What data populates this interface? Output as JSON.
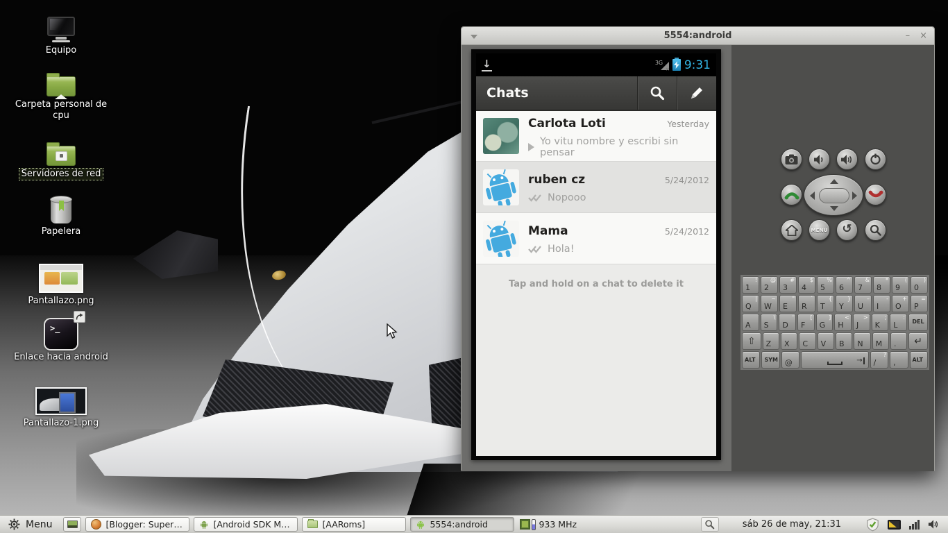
{
  "desktop": {
    "icons": [
      {
        "label": "Equipo"
      },
      {
        "label": "Carpeta personal de cpu"
      },
      {
        "label": "Servidores de red",
        "selected": true
      },
      {
        "label": "Papelera"
      },
      {
        "label": "Pantallazo.png"
      },
      {
        "label": "Enlace hacia android"
      },
      {
        "label": "Pantallazo-1.png"
      }
    ]
  },
  "window": {
    "title": "5554:android",
    "minimize_label": "–",
    "close_label": "×"
  },
  "phone": {
    "status_bar": {
      "network_label": "3G",
      "time": "9:31",
      "time_color": "#33b5e5"
    },
    "action_bar": {
      "title": "Chats"
    },
    "chat_list": [
      {
        "name": "Carlota Loti",
        "timestamp": "Yesterday",
        "preview": "Yo vitu nombre y escribi sin pensar",
        "indicator": "play",
        "avatar": "photo"
      },
      {
        "name": "ruben cz",
        "timestamp": "5/24/2012",
        "preview": "Nopooo",
        "indicator": "double-check",
        "avatar": "android-robot",
        "highlighted": true
      },
      {
        "name": "Mama",
        "timestamp": "5/24/2012",
        "preview": "Hola!",
        "indicator": "double-check",
        "avatar": "android-robot"
      }
    ],
    "hint": "Tap and hold on a chat to delete it"
  },
  "controls": {
    "menu_button_label": "MENU",
    "back_glyph": "↺"
  },
  "keyboard": {
    "rows": [
      {
        "keys": [
          {
            "l": "1",
            "s": "!"
          },
          {
            "l": "2",
            "s": "@"
          },
          {
            "l": "3",
            "s": "#"
          },
          {
            "l": "4",
            "s": "$"
          },
          {
            "l": "5",
            "s": "%"
          },
          {
            "l": "6",
            "s": "^"
          },
          {
            "l": "7",
            "s": "&"
          },
          {
            "l": "8",
            "s": "*"
          },
          {
            "l": "9",
            "s": "("
          },
          {
            "l": "0",
            "s": ")"
          }
        ]
      },
      {
        "keys": [
          {
            "l": "Q",
            "s": "|"
          },
          {
            "l": "W",
            "s": "~"
          },
          {
            "l": "E",
            "s": "\""
          },
          {
            "l": "R",
            "s": "`"
          },
          {
            "l": "T",
            "s": "{"
          },
          {
            "l": "Y",
            "s": "}"
          },
          {
            "l": "U",
            "s": "–"
          },
          {
            "l": "I",
            "s": "-"
          },
          {
            "l": "O",
            "s": "+"
          },
          {
            "l": "P",
            "s": "="
          }
        ]
      },
      {
        "keys": [
          {
            "l": "A"
          },
          {
            "l": "S",
            "s": "\\"
          },
          {
            "l": "D",
            "s": "'"
          },
          {
            "l": "F",
            "s": "["
          },
          {
            "l": "G",
            "s": "]"
          },
          {
            "l": "H",
            "s": "<"
          },
          {
            "l": "J",
            "s": ">"
          },
          {
            "l": "K",
            "s": ";"
          },
          {
            "l": "L",
            "s": ":"
          },
          {
            "l": "DEL",
            "n": "del",
            "cls": "del",
            "w": 1.15
          }
        ]
      },
      {
        "keys": [
          {
            "l": "⇧",
            "n": "shift",
            "cls": "glyph",
            "w": 1.15
          },
          {
            "l": "Z"
          },
          {
            "l": "X"
          },
          {
            "l": "C"
          },
          {
            "l": "V"
          },
          {
            "l": "B"
          },
          {
            "l": "N"
          },
          {
            "l": "M"
          },
          {
            "l": "."
          },
          {
            "l": "↵",
            "n": "enter",
            "cls": "glyph",
            "w": 1.15
          }
        ]
      },
      {
        "keys": [
          {
            "l": "ALT",
            "n": "alt-left",
            "cls": "mod"
          },
          {
            "l": "SYM",
            "n": "sym",
            "cls": "mod"
          },
          {
            "l": "@",
            "n": "at"
          },
          {
            "l": "",
            "n": "space",
            "cls": "space",
            "w": 3.9,
            "tab": "→"
          },
          {
            "l": "/",
            "s": "?",
            "n": "slash"
          },
          {
            "l": ",",
            "n": "comma"
          },
          {
            "l": "ALT",
            "n": "alt-right",
            "cls": "mod"
          }
        ]
      }
    ]
  },
  "icons": {
    "download_glyph": "↓",
    "terminal_glyph": ">_",
    "signal_x_glyph": "×"
  },
  "taskbar": {
    "menu_label": "Menu",
    "tasks": [
      {
        "label": "[Blogger: Super ...",
        "icon": "browser-globe"
      },
      {
        "label": "[Android SDK Ma...",
        "icon": "android-robot"
      },
      {
        "label": "[AARoms]",
        "icon": "folder"
      },
      {
        "label": "5554:android",
        "icon": "android-robot",
        "active": true
      }
    ],
    "cpu_label": "933 MHz",
    "clock": "sáb 26 de may, 21:31"
  },
  "colors": {
    "holo_blue": "#33b5e5",
    "robot_blue": "#44aadf",
    "android_green": "#8bc34a"
  }
}
